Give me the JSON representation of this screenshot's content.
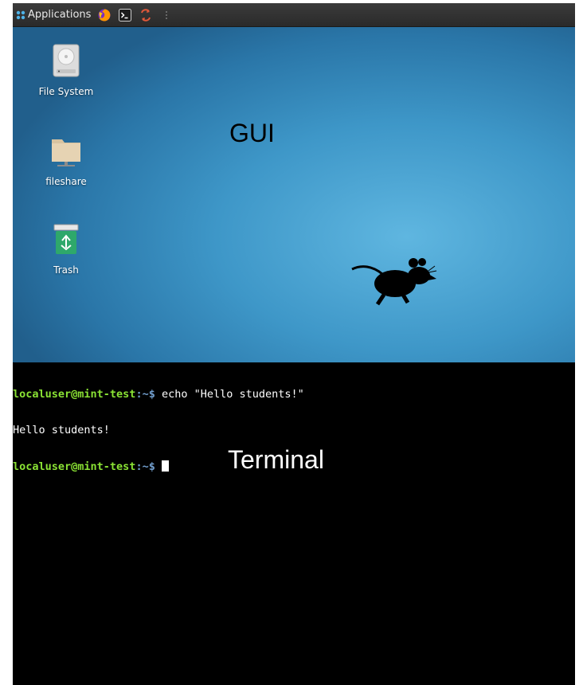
{
  "panel": {
    "applications_label": "Applications",
    "launchers": [
      "firefox-icon",
      "terminal-icon",
      "sync-icon",
      "menu-dots-icon"
    ]
  },
  "desktop": {
    "overlay_label": "GUI",
    "icons": [
      {
        "label": "File System",
        "icon": "drive-icon"
      },
      {
        "label": "fileshare",
        "icon": "folder-icon"
      },
      {
        "label": "Trash",
        "icon": "trash-icon"
      }
    ]
  },
  "terminal": {
    "overlay_label": "Terminal",
    "lines": [
      {
        "user_host": "localuser@mint-test",
        "path_prompt": ":~$",
        "command": " echo \"Hello students!\""
      },
      {
        "output": "Hello students!"
      },
      {
        "user_host": "localuser@mint-test",
        "path_prompt": ":~$",
        "command": " "
      }
    ]
  },
  "colors": {
    "prompt_user": "#8ae234",
    "prompt_path": "#729fcf",
    "terminal_bg": "#000000",
    "panel_bg": "#2f2f2f",
    "desktop_accent": "#3e97c8"
  }
}
